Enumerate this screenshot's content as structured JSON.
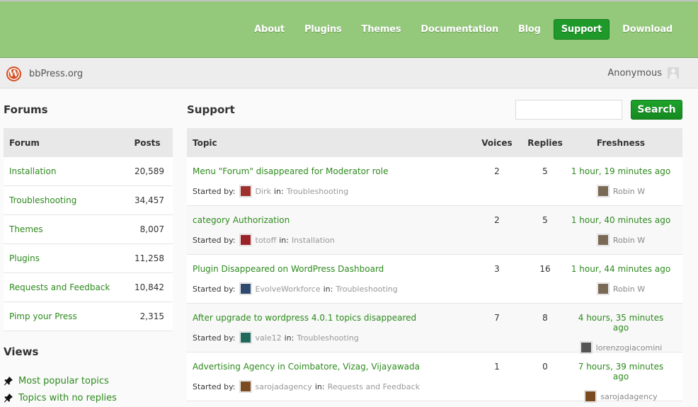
{
  "nav": {
    "items": [
      {
        "label": "About",
        "active": false
      },
      {
        "label": "Plugins",
        "active": false
      },
      {
        "label": "Themes",
        "active": false
      },
      {
        "label": "Documentation",
        "active": false
      },
      {
        "label": "Blog",
        "active": false
      },
      {
        "label": "Support",
        "active": true
      },
      {
        "label": "Download",
        "active": false
      }
    ]
  },
  "subbar": {
    "site_name": "bbPress.org",
    "logo_icon": "wordpress-logo-icon",
    "user_name": "Anonymous"
  },
  "forums": {
    "heading": "Forums",
    "col_forum": "Forum",
    "col_posts": "Posts",
    "rows": [
      {
        "name": "Installation",
        "posts": "20,589"
      },
      {
        "name": "Troubleshooting",
        "posts": "34,457"
      },
      {
        "name": "Themes",
        "posts": "8,007"
      },
      {
        "name": "Plugins",
        "posts": "11,258"
      },
      {
        "name": "Requests and Feedback",
        "posts": "10,842"
      },
      {
        "name": "Pimp your Press",
        "posts": "2,315"
      }
    ]
  },
  "views": {
    "heading": "Views",
    "items": [
      {
        "label": "Most popular topics",
        "icon": "pin-icon"
      },
      {
        "label": "Topics with no replies",
        "icon": "pin-icon"
      }
    ]
  },
  "support": {
    "heading": "Support",
    "search_value": "",
    "search_button": "Search",
    "col_topic": "Topic",
    "col_voices": "Voices",
    "col_replies": "Replies",
    "col_freshness": "Freshness",
    "started_by_label": "Started by:",
    "in_label": "in:",
    "topics": [
      {
        "title": "Menu \"Forum\" disappeared for Moderator role",
        "author": "Dirk",
        "forum": "Troubleshooting",
        "voices": "2",
        "replies": "5",
        "freshness": "1 hour, 19 minutes ago",
        "last_user": "Robin W",
        "author_color": "#a0302c",
        "last_color": "#7a6a55"
      },
      {
        "title": "category Authorization",
        "author": "totoff",
        "forum": "Installation",
        "voices": "2",
        "replies": "5",
        "freshness": "1 hour, 40 minutes ago",
        "last_user": "Robin W",
        "author_color": "#9a2228",
        "last_color": "#7a6a55"
      },
      {
        "title": "Plugin Disappeared on WordPress Dashboard",
        "author": "EvolveWorkforce",
        "forum": "Troubleshooting",
        "voices": "3",
        "replies": "16",
        "freshness": "1 hour, 44 minutes ago",
        "last_user": "Robin W",
        "author_color": "#2e4a6e",
        "last_color": "#7a6a55"
      },
      {
        "title": "After upgrade to wordpress 4.0.1 topics disappeared",
        "author": "vale12",
        "forum": "Troubleshooting",
        "voices": "7",
        "replies": "8",
        "freshness": "4 hours, 35 minutes ago",
        "last_user": "lorenzogiacomini",
        "author_color": "#1f6a5c",
        "last_color": "#555555"
      },
      {
        "title": "Advertising Agency in Coimbatore, Vizag, Vijayawada",
        "author": "sarojadagency",
        "forum": "Requests and Feedback",
        "voices": "1",
        "replies": "0",
        "freshness": "7 hours, 39 minutes ago",
        "last_user": "sarojadagency",
        "author_color": "#7a4a20",
        "last_color": "#7a4a20"
      }
    ]
  },
  "colors": {
    "topbar": "#94c97b",
    "accent_green": "#1f9a2a",
    "link_green": "#2d8a1d"
  }
}
